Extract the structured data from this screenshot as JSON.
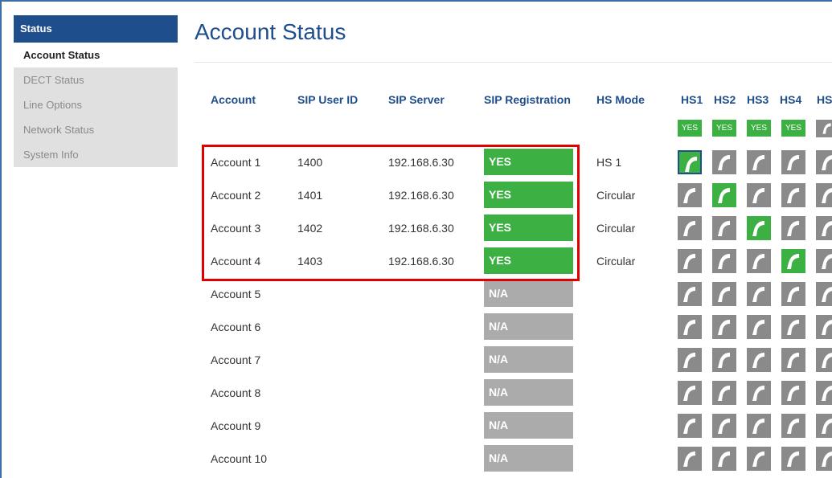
{
  "sidebar": {
    "section": "Status",
    "items": [
      {
        "label": "Account Status",
        "active": true
      },
      {
        "label": "DECT Status",
        "active": false
      },
      {
        "label": "Line Options",
        "active": false
      },
      {
        "label": "Network Status",
        "active": false
      },
      {
        "label": "System Info",
        "active": false
      }
    ]
  },
  "page_title": "Account Status",
  "table": {
    "headers": {
      "account": "Account",
      "sip_user_id": "SIP User ID",
      "sip_server": "SIP Server",
      "sip_registration": "SIP Registration",
      "hs_mode": "HS Mode",
      "hs": [
        "HS1",
        "HS2",
        "HS3",
        "HS4",
        "HS"
      ]
    },
    "hs_registered": [
      "YES",
      "YES",
      "YES",
      "YES"
    ],
    "rows": [
      {
        "account": "Account 1",
        "user": "1400",
        "server": "192.168.6.30",
        "reg": "YES",
        "mode": "HS 1",
        "phones": [
          "selected",
          "off",
          "off",
          "off",
          "off"
        ]
      },
      {
        "account": "Account 2",
        "user": "1401",
        "server": "192.168.6.30",
        "reg": "YES",
        "mode": "Circular",
        "phones": [
          "off",
          "on",
          "off",
          "off",
          "off"
        ]
      },
      {
        "account": "Account 3",
        "user": "1402",
        "server": "192.168.6.30",
        "reg": "YES",
        "mode": "Circular",
        "phones": [
          "off",
          "off",
          "on",
          "off",
          "off"
        ]
      },
      {
        "account": "Account 4",
        "user": "1403",
        "server": "192.168.6.30",
        "reg": "YES",
        "mode": "Circular",
        "phones": [
          "off",
          "off",
          "off",
          "on",
          "off"
        ]
      },
      {
        "account": "Account 5",
        "user": "",
        "server": "",
        "reg": "N/A",
        "mode": "",
        "phones": [
          "off",
          "off",
          "off",
          "off",
          "off"
        ]
      },
      {
        "account": "Account 6",
        "user": "",
        "server": "",
        "reg": "N/A",
        "mode": "",
        "phones": [
          "off",
          "off",
          "off",
          "off",
          "off"
        ]
      },
      {
        "account": "Account 7",
        "user": "",
        "server": "",
        "reg": "N/A",
        "mode": "",
        "phones": [
          "off",
          "off",
          "off",
          "off",
          "off"
        ]
      },
      {
        "account": "Account 8",
        "user": "",
        "server": "",
        "reg": "N/A",
        "mode": "",
        "phones": [
          "off",
          "off",
          "off",
          "off",
          "off"
        ]
      },
      {
        "account": "Account 9",
        "user": "",
        "server": "",
        "reg": "N/A",
        "mode": "",
        "phones": [
          "off",
          "off",
          "off",
          "off",
          "off"
        ]
      },
      {
        "account": "Account 10",
        "user": "",
        "server": "",
        "reg": "N/A",
        "mode": "",
        "phones": [
          "off",
          "off",
          "off",
          "off",
          "off"
        ]
      }
    ]
  },
  "colors": {
    "accent": "#1f4e8c",
    "yes": "#3cb043",
    "na": "#ababab",
    "highlight": "#e00000"
  },
  "icons": {
    "handset": "phone-handset-icon"
  }
}
